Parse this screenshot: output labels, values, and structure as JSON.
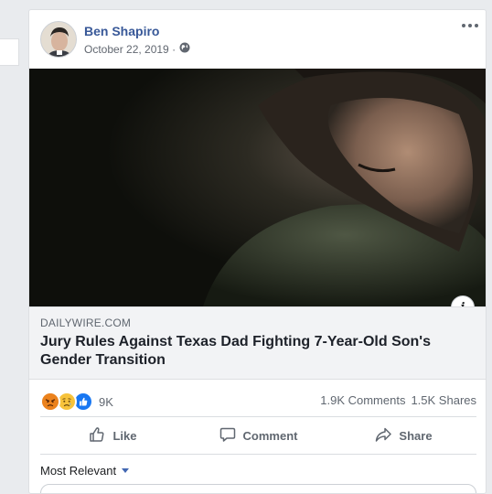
{
  "post": {
    "author": "Ben Shapiro",
    "date": "October 22, 2019 · ",
    "privacy_icon": "globe-icon",
    "more_icon": "more-dots-icon"
  },
  "link": {
    "domain": "DAILYWIRE.COM",
    "title": "Jury Rules Against Texas Dad Fighting 7-Year-Old Son's Gender Transition",
    "info_icon": "i"
  },
  "stats": {
    "reactions": [
      "angry-reaction-icon",
      "sad-reaction-icon",
      "like-reaction-icon"
    ],
    "reaction_count": "9K",
    "comments": "1.9K Comments",
    "shares": "1.5K Shares"
  },
  "actions": {
    "like": "Like",
    "comment": "Comment",
    "share": "Share"
  },
  "comments": {
    "sort_label": "Most Relevant"
  },
  "colors": {
    "link_blue": "#385898",
    "accent": "#4267b2",
    "muted": "#606770"
  }
}
